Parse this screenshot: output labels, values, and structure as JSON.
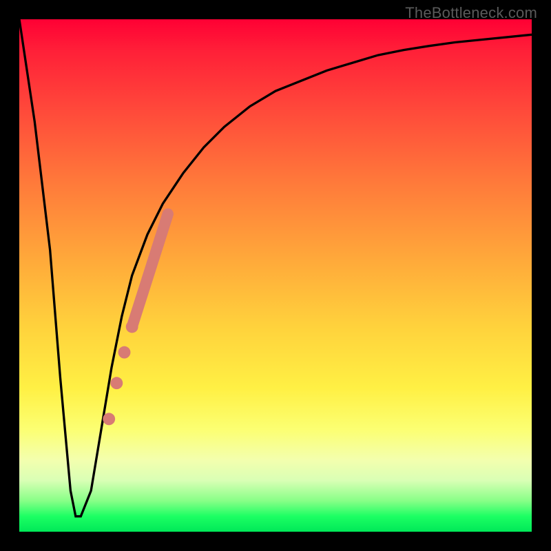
{
  "watermark": "TheBottleneck.com",
  "colors": {
    "frame": "#000000",
    "curve": "#000000",
    "markers": "#d87b74",
    "gradient_top": "#ff0034",
    "gradient_mid": "#ffd23c",
    "gradient_bottom": "#00e858"
  },
  "chart_data": {
    "type": "line",
    "title": "",
    "xlabel": "",
    "ylabel": "",
    "xlim": [
      0,
      100
    ],
    "ylim": [
      0,
      100
    ],
    "grid": false,
    "legend": false,
    "annotations": [],
    "series": [
      {
        "name": "bottleneck-curve",
        "x": [
          0,
          3,
          6,
          8,
          10,
          11,
          12,
          14,
          16,
          18,
          20,
          22,
          25,
          28,
          32,
          36,
          40,
          45,
          50,
          55,
          60,
          65,
          70,
          75,
          80,
          85,
          90,
          95,
          100
        ],
        "y": [
          100,
          80,
          55,
          30,
          8,
          3,
          3,
          8,
          20,
          32,
          42,
          50,
          58,
          64,
          70,
          75,
          79,
          83,
          86,
          88,
          90,
          91.5,
          93,
          94,
          94.8,
          95.5,
          96,
          96.5,
          97
        ]
      }
    ],
    "markers": {
      "name": "highlight-region",
      "comment": "salmon dots + thick segment along rising branch",
      "points": [
        {
          "x": 17.5,
          "y": 22,
          "r": 1.2
        },
        {
          "x": 19.0,
          "y": 29,
          "r": 1.2
        },
        {
          "x": 20.5,
          "y": 35,
          "r": 1.2
        },
        {
          "x": 22.0,
          "y": 40,
          "r": 1.2
        }
      ],
      "segment": {
        "x0": 22.0,
        "y0": 40,
        "x1": 29.0,
        "y1": 62,
        "width": 2.2
      }
    }
  }
}
